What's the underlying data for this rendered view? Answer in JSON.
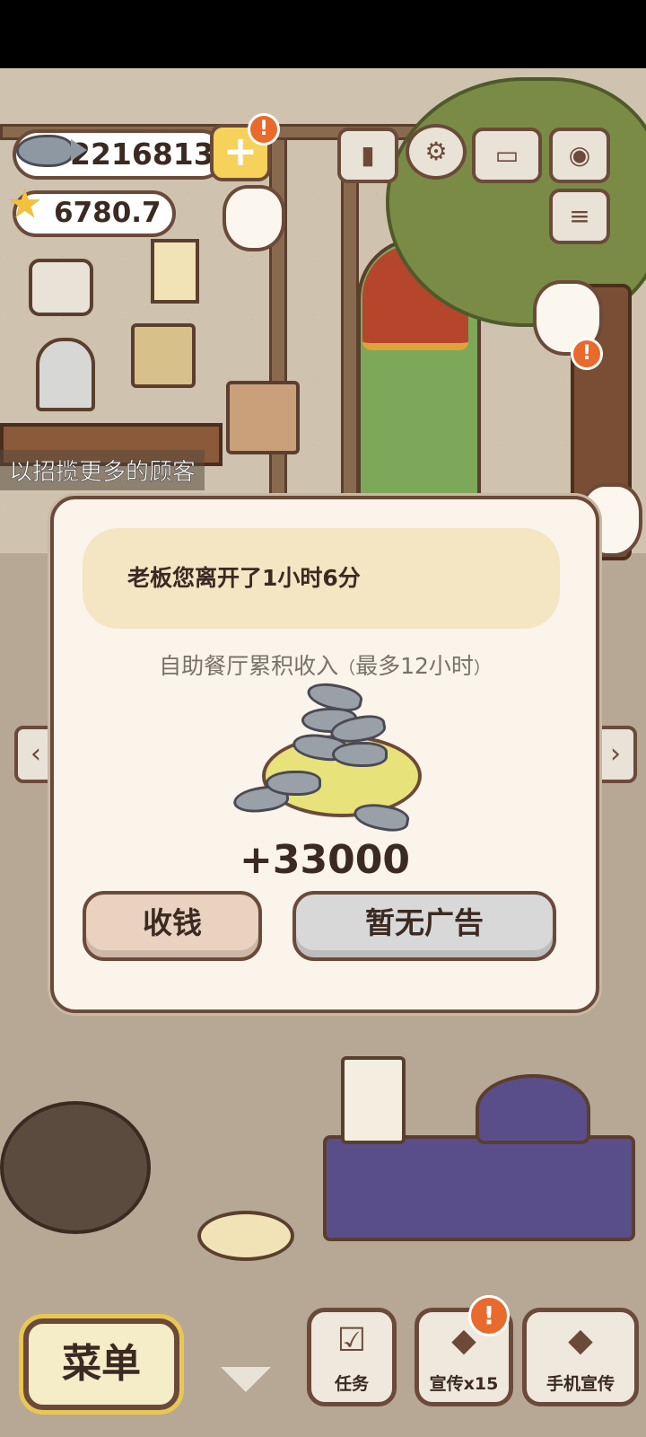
{
  "hud": {
    "fish_coins": "2216813",
    "stars": "6780.7",
    "plus_label": "+",
    "alert_mark": "!"
  },
  "top_icons": [
    "ranking-icon",
    "settings-icon",
    "recipe-book-icon",
    "camera-icon",
    "newspaper-icon"
  ],
  "scene": {
    "hint": "以招揽更多的顾客"
  },
  "dialog": {
    "banner": "老板您离开了1小时6分",
    "subtitle_main": "自助餐厅累积收入",
    "subtitle_open": "（",
    "subtitle_note": "最多12小时",
    "subtitle_close": "）",
    "reward": "+33000",
    "collect_button": "收钱",
    "ad_button": "暂无广告"
  },
  "bottom": {
    "menu": "菜单",
    "task": "任务",
    "promo": "宣传x15",
    "phone_promo": "手机宣传"
  },
  "colors": {
    "outline": "#6b4a3a",
    "modal_bg": "#fbf4ea",
    "banner_bg": "#f4e5c3",
    "collect_bg": "#ead2c0",
    "ad_bg": "#d8d8d8",
    "alert": "#e86a2c"
  }
}
